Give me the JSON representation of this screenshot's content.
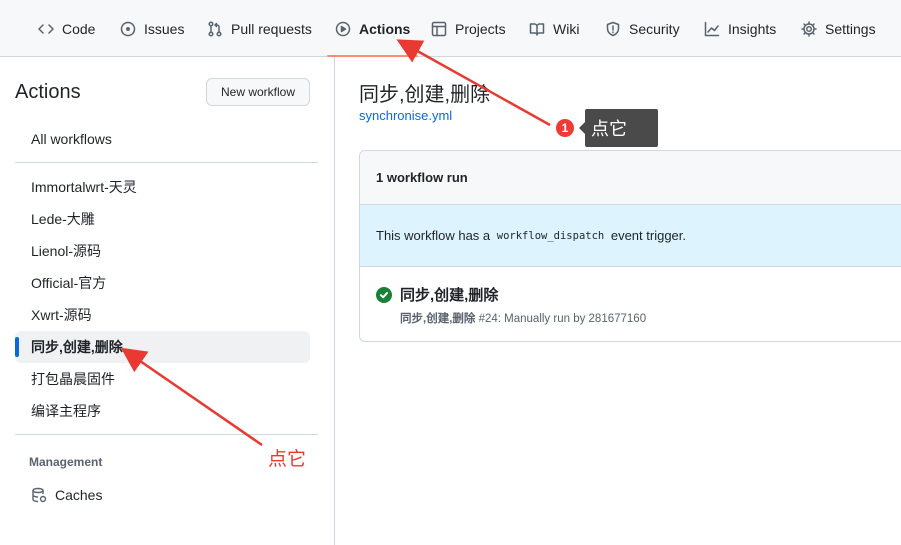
{
  "nav": {
    "tabs": [
      {
        "label": "Code",
        "icon": "code-icon"
      },
      {
        "label": "Issues",
        "icon": "issue-icon"
      },
      {
        "label": "Pull requests",
        "icon": "pull-request-icon"
      },
      {
        "label": "Actions",
        "icon": "play-icon",
        "active": true
      },
      {
        "label": "Projects",
        "icon": "table-icon"
      },
      {
        "label": "Wiki",
        "icon": "book-icon"
      },
      {
        "label": "Security",
        "icon": "shield-icon"
      },
      {
        "label": "Insights",
        "icon": "graph-icon"
      },
      {
        "label": "Settings",
        "icon": "gear-icon"
      }
    ]
  },
  "sidebar": {
    "title": "Actions",
    "new_workflow": "New workflow",
    "all_workflows": "All workflows",
    "workflows": [
      {
        "label": "Immortalwrt-天灵"
      },
      {
        "label": "Lede-大雕"
      },
      {
        "label": "Lienol-源码"
      },
      {
        "label": "Official-官方"
      },
      {
        "label": "Xwrt-源码"
      },
      {
        "label": "同步,创建,删除",
        "active": true
      },
      {
        "label": "打包晶晨固件"
      },
      {
        "label": "编译主程序"
      }
    ],
    "management": "Management",
    "caches": "Caches"
  },
  "main": {
    "title": "同步,创建,删除",
    "file_link": "synchronise.yml",
    "run_count": "1 workflow run",
    "info_prefix": "This workflow has a ",
    "info_code": "workflow_dispatch",
    "info_suffix": " event trigger.",
    "run": {
      "title": "同步,创建,删除",
      "sub_bold": "同步,创建,删除",
      "sub_rest": " #24: Manually run by 281677160",
      "status": "success"
    }
  },
  "annotations": {
    "badge_number": "1",
    "tooltip_text": "点它",
    "red_label": "点它",
    "color": "#e83a32"
  }
}
